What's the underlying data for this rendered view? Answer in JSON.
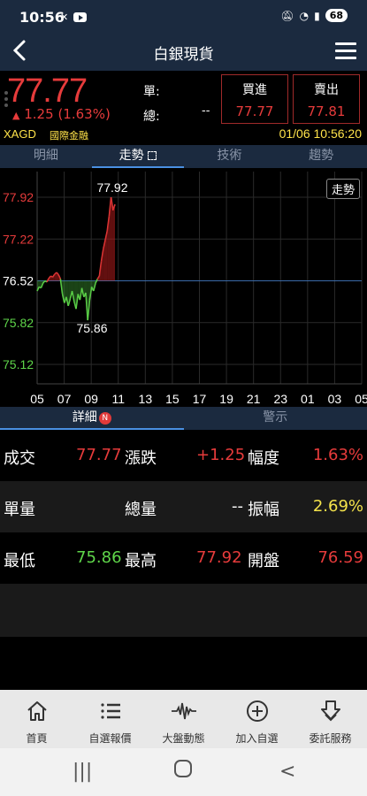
{
  "status": {
    "time": "10:56",
    "battery": "68"
  },
  "header": {
    "title": "白銀現貨",
    "back_icon": "chevron-left-icon",
    "menu_icon": "hamburger-icon"
  },
  "quote": {
    "price": "77.77",
    "change": "1.25",
    "change_pct": "(1.63%)",
    "single_label": "單:",
    "total_label": "總:",
    "total_value": "--",
    "buy_label": "買進",
    "buy_value": "77.77",
    "sell_label": "賣出",
    "sell_value": "77.81",
    "symbol": "XAGD",
    "exchange": "國際金融",
    "datetime": "01/06 10:56:20"
  },
  "tabs": [
    "明細",
    "走勢",
    "技術",
    "趨勢"
  ],
  "chart_data": {
    "type": "line",
    "y_ticks": [
      "77.92",
      "77.22",
      "76.52",
      "75.82",
      "75.12"
    ],
    "x_ticks": [
      "05",
      "07",
      "09",
      "11",
      "13",
      "15",
      "17",
      "19",
      "21",
      "23",
      "01",
      "03",
      "05"
    ],
    "reference": 76.52,
    "ylim": [
      75.12,
      77.92
    ],
    "high_label": "77.92",
    "low_label": "75.86",
    "button_label": "走勢",
    "colors": {
      "up": "#e63b3b",
      "down": "#5fd64a",
      "ref": "#3a6aa8"
    }
  },
  "subtabs": {
    "detail": "詳細",
    "alert": "警示",
    "badge": "N"
  },
  "stats": {
    "row1": {
      "l1": "成交",
      "v1": "77.77",
      "l2": "漲跌",
      "v2": "+1.25",
      "l3": "幅度",
      "v3": "1.63%"
    },
    "row2": {
      "l1": "單量",
      "v1": "",
      "l2": "總量",
      "v2": "--",
      "l3": "振幅",
      "v3": "2.69%"
    },
    "row3": {
      "l1": "最低",
      "v1": "75.86",
      "l2": "最高",
      "v2": "77.92",
      "l3": "開盤",
      "v3": "76.59"
    }
  },
  "bottom_nav": [
    {
      "label": "首頁",
      "icon": "home-icon"
    },
    {
      "label": "自選報價",
      "icon": "list-icon"
    },
    {
      "label": "大盤動態",
      "icon": "pulse-icon"
    },
    {
      "label": "加入自選",
      "icon": "plus-circle-icon"
    },
    {
      "label": "委託服務",
      "icon": "download-icon"
    }
  ]
}
